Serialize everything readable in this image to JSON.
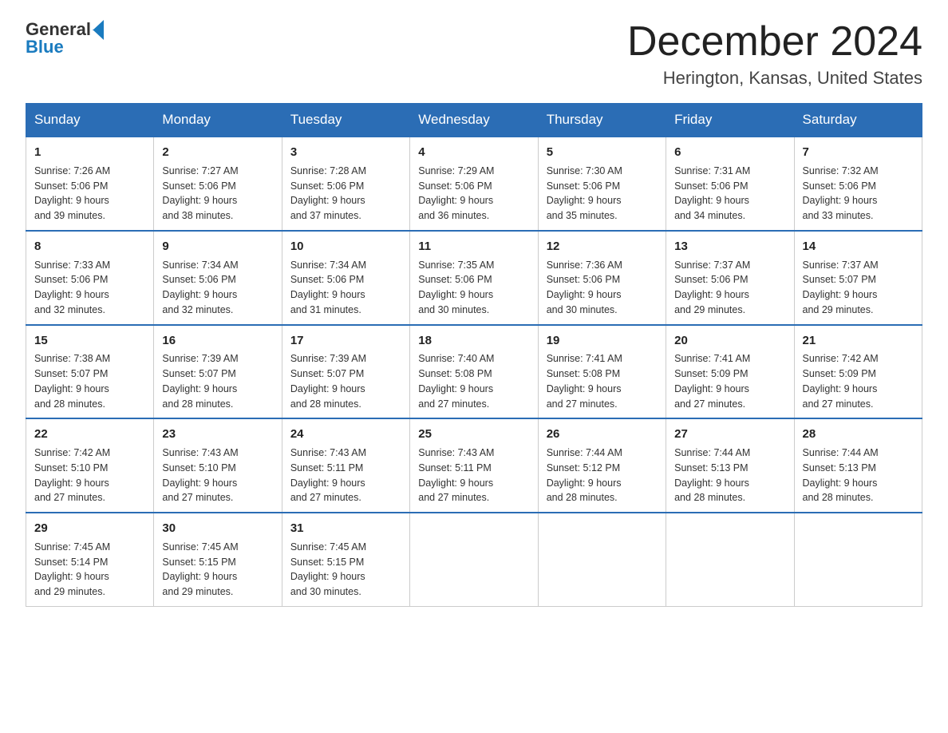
{
  "header": {
    "logo": {
      "text_general": "General",
      "text_blue": "Blue"
    },
    "title": "December 2024",
    "subtitle": "Herington, Kansas, United States"
  },
  "days_of_week": [
    "Sunday",
    "Monday",
    "Tuesday",
    "Wednesday",
    "Thursday",
    "Friday",
    "Saturday"
  ],
  "weeks": [
    [
      {
        "day": "1",
        "sunrise": "7:26 AM",
        "sunset": "5:06 PM",
        "daylight": "9 hours and 39 minutes."
      },
      {
        "day": "2",
        "sunrise": "7:27 AM",
        "sunset": "5:06 PM",
        "daylight": "9 hours and 38 minutes."
      },
      {
        "day": "3",
        "sunrise": "7:28 AM",
        "sunset": "5:06 PM",
        "daylight": "9 hours and 37 minutes."
      },
      {
        "day": "4",
        "sunrise": "7:29 AM",
        "sunset": "5:06 PM",
        "daylight": "9 hours and 36 minutes."
      },
      {
        "day": "5",
        "sunrise": "7:30 AM",
        "sunset": "5:06 PM",
        "daylight": "9 hours and 35 minutes."
      },
      {
        "day": "6",
        "sunrise": "7:31 AM",
        "sunset": "5:06 PM",
        "daylight": "9 hours and 34 minutes."
      },
      {
        "day": "7",
        "sunrise": "7:32 AM",
        "sunset": "5:06 PM",
        "daylight": "9 hours and 33 minutes."
      }
    ],
    [
      {
        "day": "8",
        "sunrise": "7:33 AM",
        "sunset": "5:06 PM",
        "daylight": "9 hours and 32 minutes."
      },
      {
        "day": "9",
        "sunrise": "7:34 AM",
        "sunset": "5:06 PM",
        "daylight": "9 hours and 32 minutes."
      },
      {
        "day": "10",
        "sunrise": "7:34 AM",
        "sunset": "5:06 PM",
        "daylight": "9 hours and 31 minutes."
      },
      {
        "day": "11",
        "sunrise": "7:35 AM",
        "sunset": "5:06 PM",
        "daylight": "9 hours and 30 minutes."
      },
      {
        "day": "12",
        "sunrise": "7:36 AM",
        "sunset": "5:06 PM",
        "daylight": "9 hours and 30 minutes."
      },
      {
        "day": "13",
        "sunrise": "7:37 AM",
        "sunset": "5:06 PM",
        "daylight": "9 hours and 29 minutes."
      },
      {
        "day": "14",
        "sunrise": "7:37 AM",
        "sunset": "5:07 PM",
        "daylight": "9 hours and 29 minutes."
      }
    ],
    [
      {
        "day": "15",
        "sunrise": "7:38 AM",
        "sunset": "5:07 PM",
        "daylight": "9 hours and 28 minutes."
      },
      {
        "day": "16",
        "sunrise": "7:39 AM",
        "sunset": "5:07 PM",
        "daylight": "9 hours and 28 minutes."
      },
      {
        "day": "17",
        "sunrise": "7:39 AM",
        "sunset": "5:07 PM",
        "daylight": "9 hours and 28 minutes."
      },
      {
        "day": "18",
        "sunrise": "7:40 AM",
        "sunset": "5:08 PM",
        "daylight": "9 hours and 27 minutes."
      },
      {
        "day": "19",
        "sunrise": "7:41 AM",
        "sunset": "5:08 PM",
        "daylight": "9 hours and 27 minutes."
      },
      {
        "day": "20",
        "sunrise": "7:41 AM",
        "sunset": "5:09 PM",
        "daylight": "9 hours and 27 minutes."
      },
      {
        "day": "21",
        "sunrise": "7:42 AM",
        "sunset": "5:09 PM",
        "daylight": "9 hours and 27 minutes."
      }
    ],
    [
      {
        "day": "22",
        "sunrise": "7:42 AM",
        "sunset": "5:10 PM",
        "daylight": "9 hours and 27 minutes."
      },
      {
        "day": "23",
        "sunrise": "7:43 AM",
        "sunset": "5:10 PM",
        "daylight": "9 hours and 27 minutes."
      },
      {
        "day": "24",
        "sunrise": "7:43 AM",
        "sunset": "5:11 PM",
        "daylight": "9 hours and 27 minutes."
      },
      {
        "day": "25",
        "sunrise": "7:43 AM",
        "sunset": "5:11 PM",
        "daylight": "9 hours and 27 minutes."
      },
      {
        "day": "26",
        "sunrise": "7:44 AM",
        "sunset": "5:12 PM",
        "daylight": "9 hours and 28 minutes."
      },
      {
        "day": "27",
        "sunrise": "7:44 AM",
        "sunset": "5:13 PM",
        "daylight": "9 hours and 28 minutes."
      },
      {
        "day": "28",
        "sunrise": "7:44 AM",
        "sunset": "5:13 PM",
        "daylight": "9 hours and 28 minutes."
      }
    ],
    [
      {
        "day": "29",
        "sunrise": "7:45 AM",
        "sunset": "5:14 PM",
        "daylight": "9 hours and 29 minutes."
      },
      {
        "day": "30",
        "sunrise": "7:45 AM",
        "sunset": "5:15 PM",
        "daylight": "9 hours and 29 minutes."
      },
      {
        "day": "31",
        "sunrise": "7:45 AM",
        "sunset": "5:15 PM",
        "daylight": "9 hours and 30 minutes."
      },
      null,
      null,
      null,
      null
    ]
  ],
  "labels": {
    "sunrise": "Sunrise:",
    "sunset": "Sunset:",
    "daylight": "Daylight:"
  }
}
